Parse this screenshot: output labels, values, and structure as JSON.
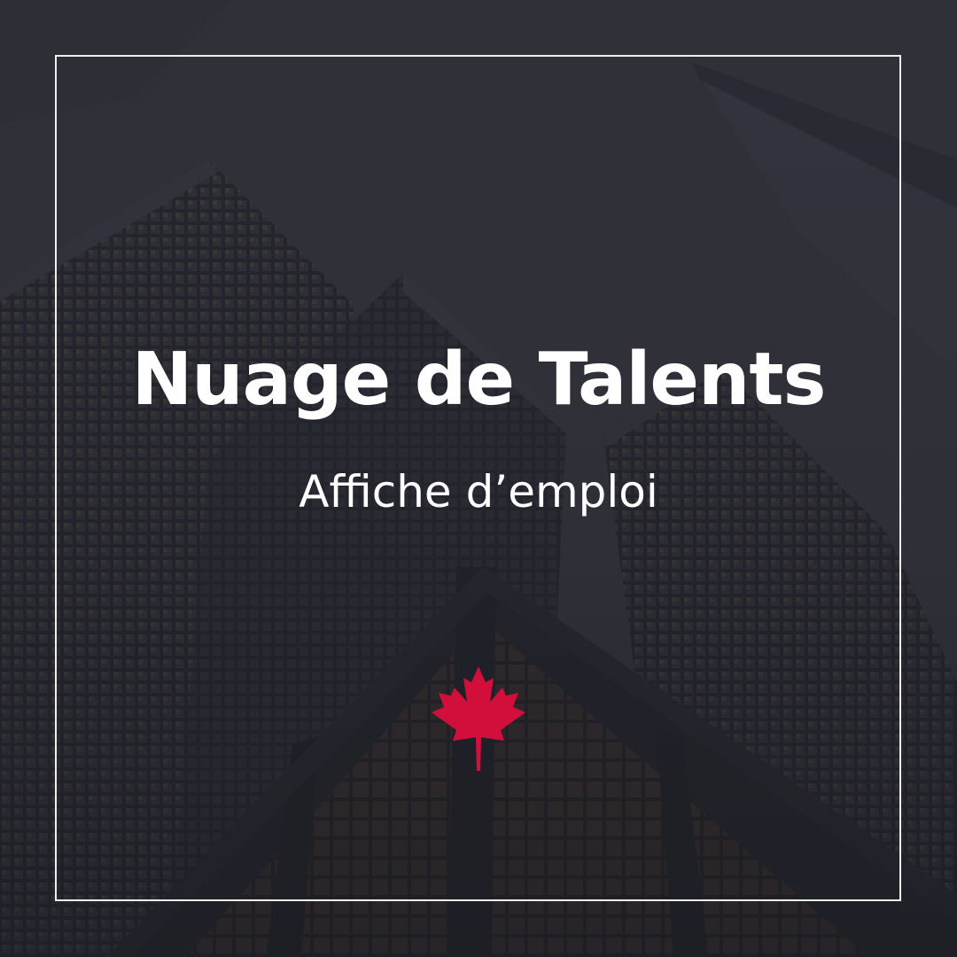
{
  "poster": {
    "title": "Nuage de Talents",
    "subtitle": "Affiche d’emploi",
    "emblem_icon": "maple-leaf-icon",
    "colors": {
      "accent": "#d10f3a",
      "text": "#ffffff",
      "overlay": "#2b2c35"
    }
  }
}
